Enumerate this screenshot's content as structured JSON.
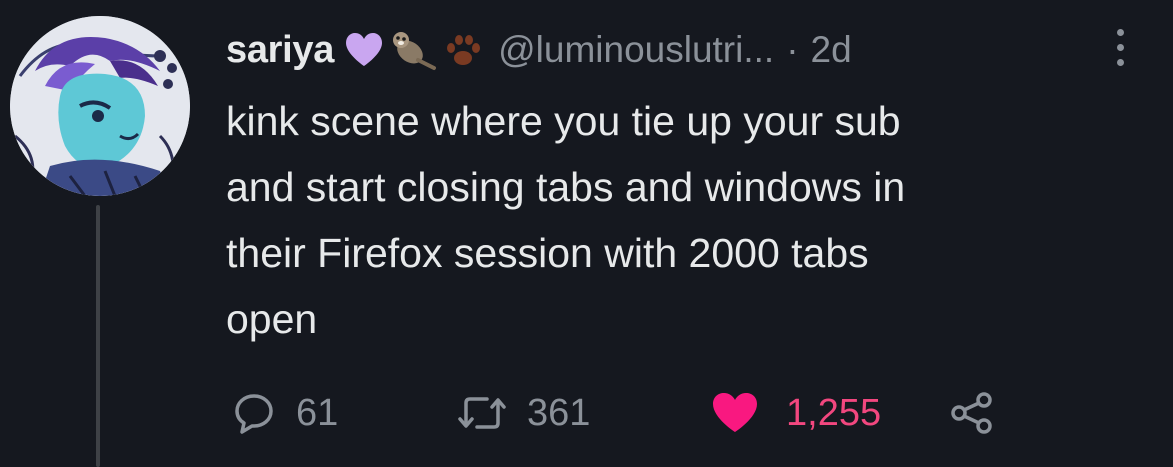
{
  "author": {
    "display_name": "sariya",
    "handle": "@luminouslutri...",
    "separator": "·",
    "time": "2d"
  },
  "tweet": {
    "lines": [
      "kink scene where you tie up your sub",
      "and start closing tabs and windows in",
      "their Firefox session with 2000 tabs",
      "open"
    ]
  },
  "actions": {
    "replies": "61",
    "retweets": "361",
    "likes": "1,255"
  },
  "icons": {
    "badges": [
      "purple-heart-icon",
      "otter-icon",
      "paw-icon"
    ],
    "actions": [
      "reply-icon",
      "retweet-icon",
      "like-icon",
      "share-icon"
    ],
    "menu": "more-options-icon"
  },
  "colors": {
    "background": "#15181f",
    "text": "#e7e9ea",
    "muted": "#8b9199",
    "like": "#f91880",
    "badge_heart": "#c9a6f0"
  }
}
